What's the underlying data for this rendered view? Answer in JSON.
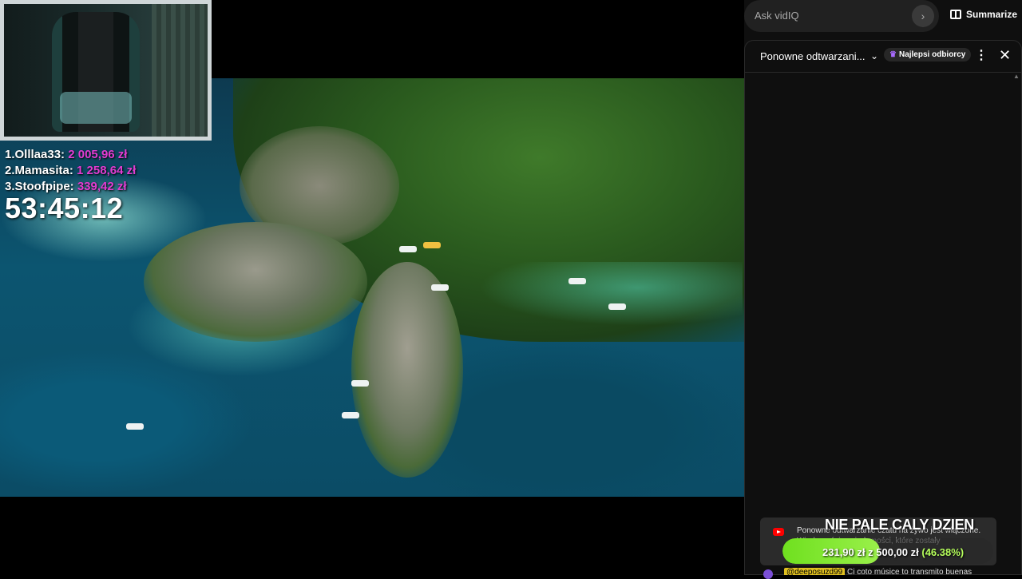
{
  "leaderboard": [
    {
      "rank": "1.",
      "name": "Olllaa33:",
      "amount": "2 005,96 zł"
    },
    {
      "rank": "2.",
      "name": "Mamasita:",
      "amount": "1 258,64 zł"
    },
    {
      "rank": "3.",
      "name": "Stoofpipe:",
      "amount": "339,42 zł"
    }
  ],
  "timer": "53:45:12",
  "vidiq": {
    "placeholder": "Ask vidIQ",
    "go_glyph": "›",
    "summarize_label": "Summarize"
  },
  "chat": {
    "title": "Ponowne odtwarzani...",
    "badge_label": "Najlepsi odbiorcy",
    "replay_notice": "Ponowne odtwarzanie czatu na żywo jest włączone.",
    "replay_sub": "Wiadomości... wiadomości, które zostały",
    "bottom_user": "@deeposuzd99",
    "bottom_message": "Ci coto músice to transmito buenas"
  },
  "goal": {
    "title": "NIE PALE CALY DZIEN",
    "current": "231,90 zł",
    "separator": "z",
    "target": "500,00 zł",
    "percent_text": "(46.38%)",
    "percent": 46.38
  },
  "colors": {
    "accent_magenta": "#e23cd2",
    "goal_green": "#6fe01f"
  }
}
